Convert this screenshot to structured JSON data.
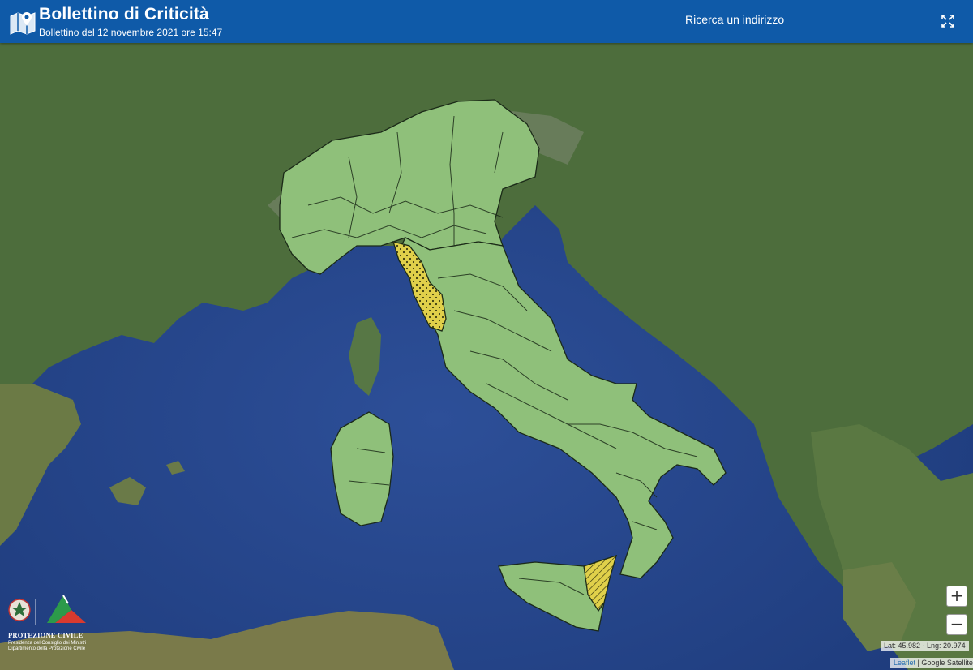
{
  "header": {
    "title": "Bollettino di Criticità",
    "subtitle": "Bollettino del 12 novembre 2021 ore 15:47",
    "search_placeholder": "Ricerca un indirizzo",
    "fullscreen_icon": "fullscreen-icon",
    "logo_icon": "map-pin-icon"
  },
  "colors": {
    "header": "#0f5aa8",
    "sea": "#2c4f9a",
    "land": "#4a6b3b",
    "zone_green": "#8fc07a",
    "zone_yellow": "#e0d04a",
    "zone_border": "#1b2a18"
  },
  "map": {
    "zoom_in": "+",
    "zoom_out": "−",
    "coordinates": "Lat: 45.982 - Lng: 20.974",
    "attribution_leaflet": "Leaflet",
    "attribution_sep": " | ",
    "attribution_source": "Google Satellite"
  },
  "legend_levels": [
    "green",
    "yellow"
  ],
  "footer_logo": {
    "name": "PROTEZIONE CIVILE",
    "line1": "Presidenza del Consiglio dei Ministri",
    "line2": "Dipartimento della Protezione Civile"
  }
}
